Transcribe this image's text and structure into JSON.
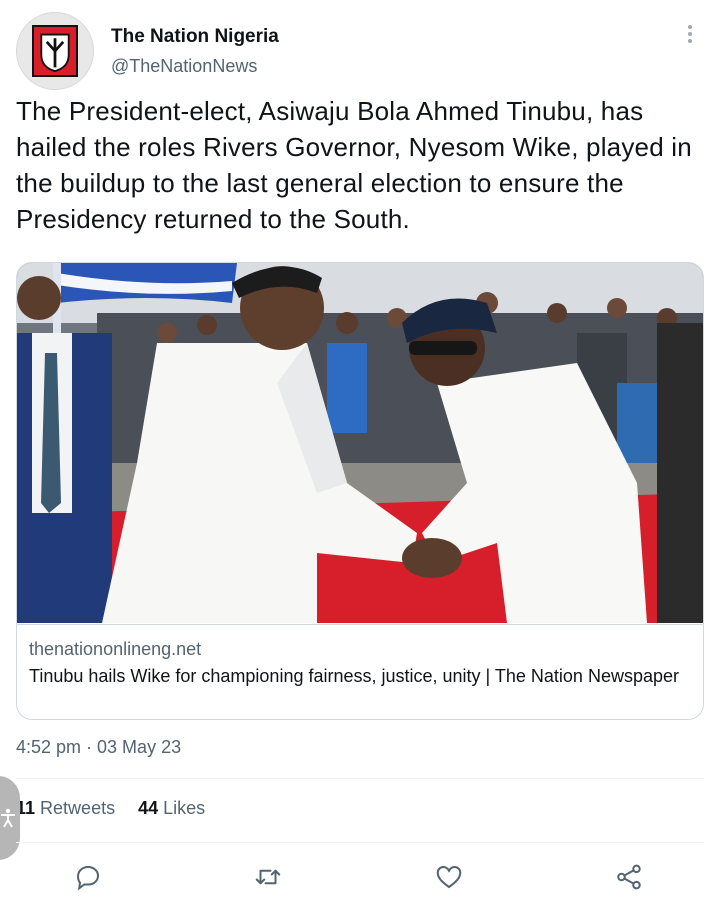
{
  "author": {
    "display_name": "The Nation Nigeria",
    "handle": "@TheNationNews"
  },
  "tweet": {
    "text": "The President-elect, Asiwaju Bola Ahmed Tinubu, has hailed the roles Rivers Governor, Nyesom Wike, played in the buildup to the last general election to ensure the Presidency returned to the South.",
    "timestamp": "4:52 pm · 03 May 23"
  },
  "card": {
    "domain": "thenationonlineng.net",
    "title": "Tinubu hails Wike for championing fairness, justice, unity | The Nation Newspaper"
  },
  "stats": {
    "retweets_count": "11",
    "retweets_label": "Retweets",
    "likes_count": "44",
    "likes_label": "Likes"
  },
  "icons": {
    "more": "more-vertical-icon",
    "reply": "reply-icon",
    "retweet": "retweet-icon",
    "like": "heart-icon",
    "share": "share-icon",
    "accessibility": "accessibility-icon"
  },
  "colors": {
    "text": "#0f1419",
    "muted": "#536471",
    "border": "#cfd9de",
    "icon": "#536471"
  }
}
